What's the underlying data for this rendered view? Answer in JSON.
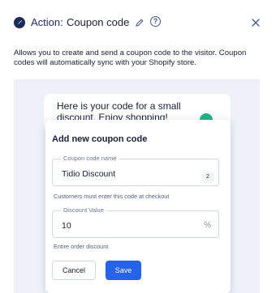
{
  "header": {
    "title_prefix": "Action:",
    "title_name": "Coupon code",
    "icons": [
      "action-icon",
      "pencil-icon",
      "help-icon",
      "close-icon"
    ]
  },
  "description": "Allows you to create and send a coupon code to the visitor. Coupon codes will automatically sync with your Shopify store.",
  "preview": {
    "message": "Here is your code for a small discount. Enjoy shopping!"
  },
  "modal": {
    "title": "Add new coupon code",
    "coupon_name": {
      "label": "Coupon code name",
      "value": "Tidio Discount",
      "char_count": "2",
      "helper": "Customers must enter this code at checkout"
    },
    "discount_value": {
      "label": "Discount Value",
      "value": "10",
      "unit": "%",
      "helper": "Entire order discount"
    },
    "cancel_label": "Cancel",
    "save_label": "Save"
  },
  "colors": {
    "accent": "#2563eb",
    "header_icon": "#1c2b5a",
    "preview_bg": "#eef2f8",
    "badge": "#20b286"
  }
}
